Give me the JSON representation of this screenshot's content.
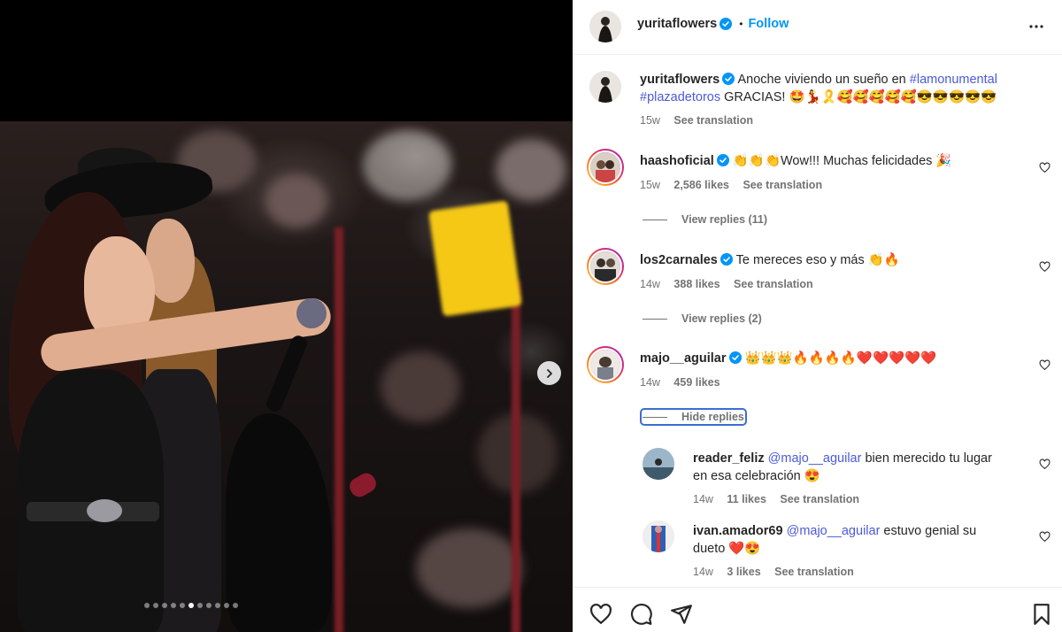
{
  "post": {
    "author": "yuritaflowers",
    "follow_label": "Follow",
    "separator": "•",
    "caption_prefix": "Anoche viviendo un sueño en ",
    "caption_tag1": "#lamonumental",
    "caption_tag2": "#plazadetoros",
    "caption_suffix": " GRACIAS! 🤩💃🎗️🥰🥰🥰🥰🥰😎😎😎😎😎",
    "time": "15w",
    "see_translation": "See translation"
  },
  "media": {
    "carousel_count": 11,
    "carousel_active": 5
  },
  "comments": [
    {
      "username": "haashoficial",
      "text": "👏👏👏Wow!!! Muchas felicidades 🎉",
      "time": "15w",
      "likes": "2,586 likes",
      "action": "See translation",
      "replies_label": "View replies (11)"
    },
    {
      "username": "los2carnales",
      "text": "Te mereces eso y más 👏🔥",
      "time": "14w",
      "likes": "388 likes",
      "action": "See translation",
      "replies_label": "View replies (2)"
    },
    {
      "username": "majo__aguilar",
      "text": "👑👑👑🔥🔥🔥🔥❤️❤️❤️❤️❤️",
      "time": "14w",
      "likes": "459 likes",
      "replies_label": "Hide replies"
    }
  ],
  "replies": [
    {
      "username": "reader_feliz",
      "mention": "@majo__aguilar",
      "text_line1": " bien merecido tu lugar",
      "text_line2": "en esa celebración 😍",
      "time": "14w",
      "likes": "11 likes",
      "action": "See translation"
    },
    {
      "username": "ivan.amador69",
      "mention": "@majo__aguilar",
      "text_line1": " estuvo genial su",
      "text_line2": "dueto ❤️😍",
      "time": "14w",
      "likes": "3 likes",
      "action": "See translation"
    }
  ],
  "icons": {
    "more": "more-options-icon",
    "like": "heart-icon",
    "comment": "comment-icon",
    "share": "share-icon",
    "save": "bookmark-icon",
    "next": "chevron-right-icon"
  },
  "colors": {
    "accent": "#0095f6",
    "link": "#4a5bd9",
    "verified": "#0095f6"
  }
}
